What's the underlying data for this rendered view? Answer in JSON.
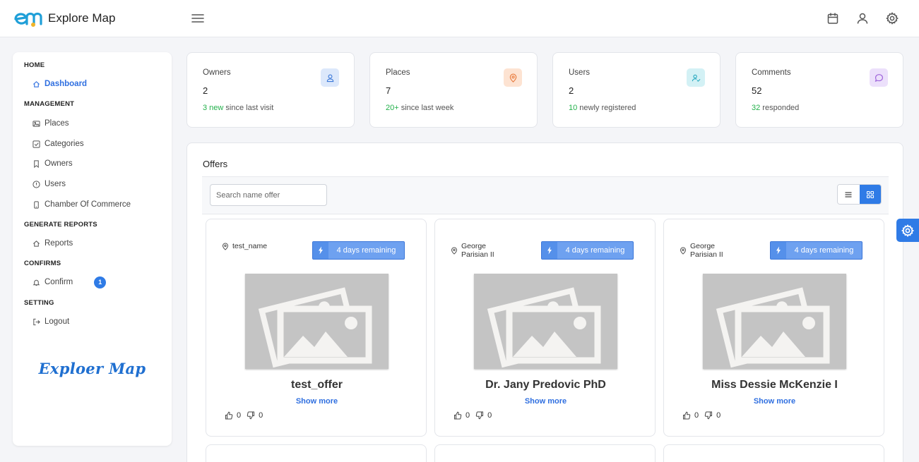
{
  "header": {
    "brand": "Explore Map",
    "icons": [
      "menu-icon",
      "calendar-icon",
      "user-icon",
      "settings-icon"
    ]
  },
  "sidebar": {
    "sections": [
      {
        "title": "HOME",
        "items": [
          {
            "label": "Dashboard",
            "icon": "home-icon",
            "active": true
          }
        ]
      },
      {
        "title": "MANAGEMENT",
        "items": [
          {
            "label": "Places",
            "icon": "image-icon"
          },
          {
            "label": "Categories",
            "icon": "checkbox-icon"
          },
          {
            "label": "Owners",
            "icon": "bookmark-icon"
          },
          {
            "label": "Users",
            "icon": "info-icon"
          },
          {
            "label": "Chamber Of Commerce",
            "icon": "phone-icon"
          }
        ]
      },
      {
        "title": "GENERATE REPORTS",
        "items": [
          {
            "label": "Reports",
            "icon": "home-icon"
          }
        ]
      },
      {
        "title": "CONFIRMS",
        "items": [
          {
            "label": "Confirm",
            "icon": "bell-icon",
            "badge": "1"
          }
        ]
      },
      {
        "title": "SETTING",
        "items": [
          {
            "label": "Logout",
            "icon": "logout-icon"
          }
        ]
      }
    ],
    "footer_logo": "Exploer Map"
  },
  "stats": [
    {
      "label": "Owners",
      "value": "2",
      "highlight": "3 new",
      "rest": " since last visit",
      "icon": "user-icon",
      "icon_bg": "#dce8fb",
      "icon_color": "#3b78d8"
    },
    {
      "label": "Places",
      "value": "7",
      "highlight": "20+",
      "rest": " since last week",
      "icon": "map-pin-icon",
      "icon_bg": "#fde3d2",
      "icon_color": "#e87a3c"
    },
    {
      "label": "Users",
      "value": "2",
      "highlight": "10",
      "rest": " newly registered",
      "icon": "user-check-icon",
      "icon_bg": "#d3f1f5",
      "icon_color": "#27a9bf"
    },
    {
      "label": "Comments",
      "value": "52",
      "highlight": "32",
      "rest": " responded",
      "icon": "message-icon",
      "icon_bg": "#ece0fb",
      "icon_color": "#9b5ed9"
    }
  ],
  "offers": {
    "title": "Offers",
    "search_placeholder": "Search name offer",
    "show_more": "Show more",
    "cards": [
      {
        "location": "test_name",
        "remaining": "4 days remaining",
        "title": "test_offer",
        "likes": "0",
        "dislikes": "0"
      },
      {
        "location": "George Parisian II",
        "remaining": "4 days remaining",
        "title": "Dr. Jany Predovic PhD",
        "likes": "0",
        "dislikes": "0"
      },
      {
        "location": "George Parisian II",
        "remaining": "4 days remaining",
        "title": "Miss Dessie McKenzie I",
        "likes": "0",
        "dislikes": "0"
      }
    ]
  },
  "colors": {
    "accent": "#2f7be6",
    "positive": "#22b04a"
  }
}
